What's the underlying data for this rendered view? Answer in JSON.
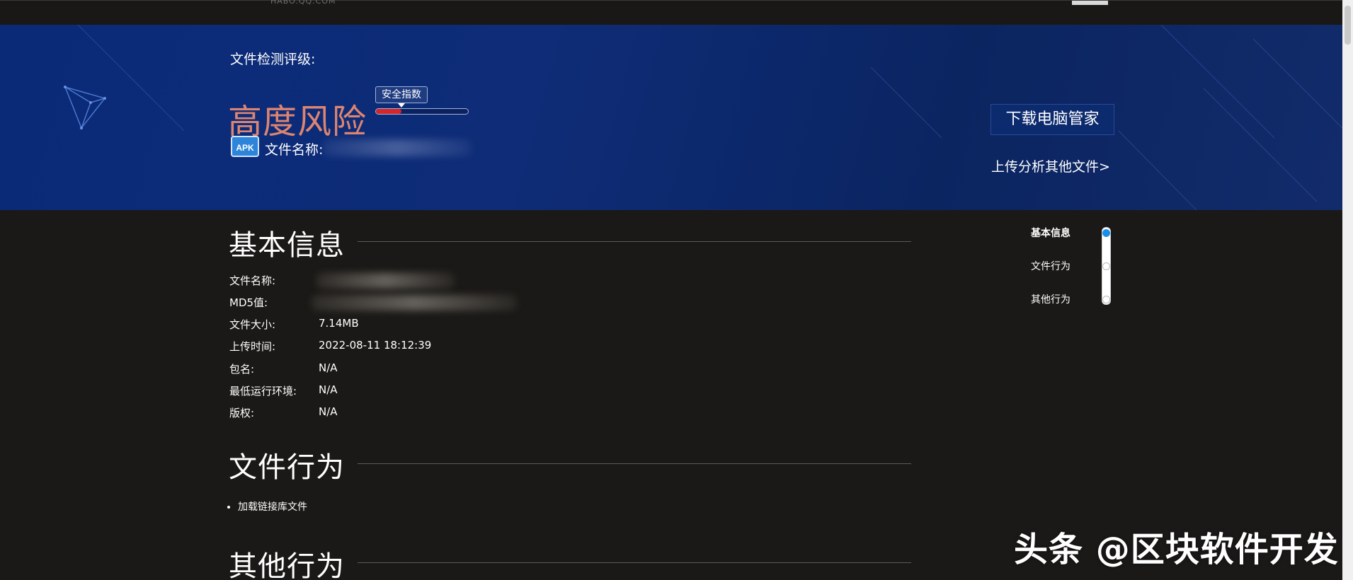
{
  "topbar": {
    "logo_text": "HABO.QQ.COM"
  },
  "hero": {
    "detect_label": "文件检测评级:",
    "risk_level": "高度风险",
    "safety_badge": "安全指数",
    "safety_index_fraction": 0.28,
    "file_icon_text": "APK",
    "filename_label": "文件名称:",
    "download_button": "下载电脑管家",
    "upload_link": "上传分析其他文件>"
  },
  "basic_info": {
    "title": "基本信息",
    "rows": [
      {
        "label": "文件名称:",
        "value": ""
      },
      {
        "label": "MD5值:",
        "value": ""
      },
      {
        "label": "文件大小:",
        "value": "7.14MB"
      },
      {
        "label": "上传时间:",
        "value": "2022-08-11 18:12:39"
      },
      {
        "label": "包名:",
        "value": "N/A"
      },
      {
        "label": "最低运行环境:",
        "value": "N/A"
      },
      {
        "label": "版权:",
        "value": "N/A"
      }
    ]
  },
  "file_behavior": {
    "title": "文件行为",
    "items": [
      "加载链接库文件"
    ]
  },
  "other_behavior": {
    "title": "其他行为"
  },
  "right_nav": {
    "items": [
      "基本信息",
      "文件行为",
      "其他行为"
    ],
    "active_index": 0
  },
  "watermark": "头条 @区块软件开发",
  "colors": {
    "risk": "#dd8571",
    "hero_bg": "#0e2c77",
    "page_bg": "#1b1917",
    "nav_active": "#1d8ee8",
    "safety_fill": "#d4262b"
  }
}
